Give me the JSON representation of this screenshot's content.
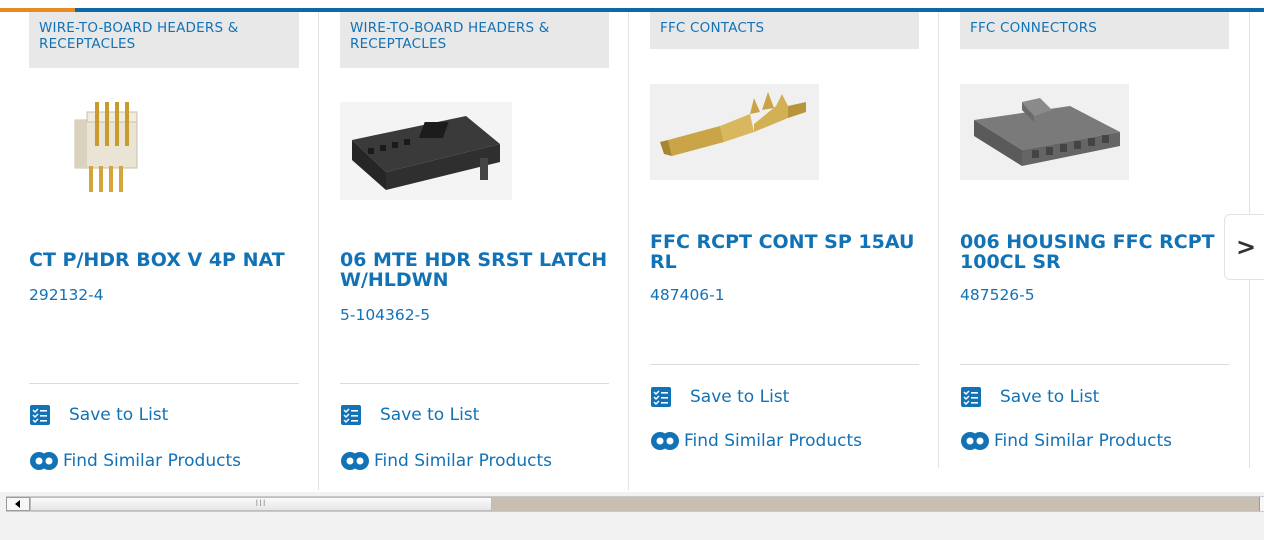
{
  "products": [
    {
      "category": "WIRE-TO-BOARD HEADERS & RECEPTACLES",
      "name": "CT P/HDR BOX V 4P NAT",
      "part_number": "292132-4",
      "save_label": "Save to List",
      "find_label": "Find Similar Products",
      "image_icon": "pin-header-image"
    },
    {
      "category": "WIRE-TO-BOARD HEADERS & RECEPTACLES",
      "name": "06 MTE HDR SRST LATCH W/HLDWN",
      "part_number": "5-104362-5",
      "save_label": "Save to List",
      "find_label": "Find Similar Products",
      "image_icon": "latch-header-image"
    },
    {
      "category": "FFC CONTACTS",
      "name": "FFC RCPT CONT SP 15AU RL",
      "part_number": "487406-1",
      "save_label": "Save to List",
      "find_label": "Find Similar Products",
      "image_icon": "crimp-contact-image"
    },
    {
      "category": "FFC CONNECTORS",
      "name": "006 HOUSING FFC RCPT 100CL SR",
      "part_number": "487526-5",
      "save_label": "Save to List",
      "find_label": "Find Similar Products",
      "image_icon": "ffc-housing-image"
    }
  ],
  "carousel": {
    "next_glyph": ">"
  },
  "scrollbar": {
    "grip": "III"
  },
  "colors": {
    "link": "#1272b6",
    "brand_bar": "#0b6aa2",
    "accent_bar": "#e98a1e",
    "category_bg": "#e8e8e8"
  }
}
